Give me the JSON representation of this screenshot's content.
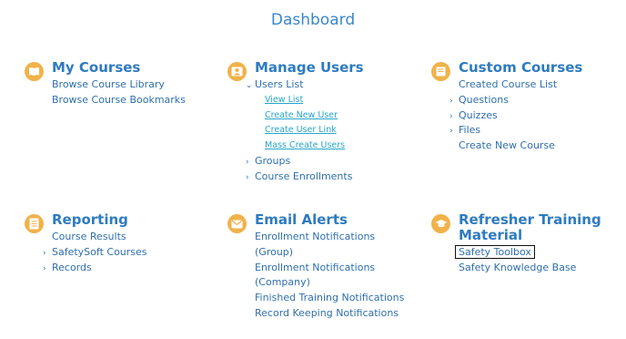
{
  "page_title": "Dashboard",
  "sections": {
    "my_courses": {
      "icon": "book-icon",
      "title": "My Courses",
      "items": [
        "Browse Course Library",
        "Browse Course Bookmarks"
      ]
    },
    "manage_users": {
      "icon": "user-card-icon",
      "title": "Manage Users",
      "users_list": "Users List",
      "users_list_children": [
        "View List",
        "Create New User",
        "Create User Link",
        "Mass Create Users"
      ],
      "groups": "Groups",
      "course_enrollments": "Course Enrollments"
    },
    "custom_courses": {
      "icon": "book-icon",
      "title": "Custom Courses",
      "created_course_list": "Created Course List",
      "questions": "Questions",
      "quizzes": "Quizzes",
      "files": "Files",
      "create_new_course": "Create New Course"
    },
    "reporting": {
      "icon": "report-icon",
      "title": "Reporting",
      "course_results": "Course Results",
      "safetysoft_courses": "SafetySoft Courses",
      "records": "Records"
    },
    "email_alerts": {
      "icon": "envelope-icon",
      "title": "Email Alerts",
      "items": [
        "Enrollment Notifications",
        "(Group)",
        "Enrollment Notifications",
        "(Company)",
        "Finished Training Notifications",
        "Record Keeping Notifications"
      ]
    },
    "refresher": {
      "icon": "graduation-cap-icon",
      "title_line1": "Refresher Training",
      "title_line2": "Material",
      "safety_toolbox": "Safety Toolbox",
      "safety_knowledge_base": "Safety Knowledge Base"
    }
  },
  "colors": {
    "accent": "#2e7bc0",
    "link": "#2f6fae",
    "sublink": "#27a6c9",
    "icon_bg": "#f1b24a"
  }
}
